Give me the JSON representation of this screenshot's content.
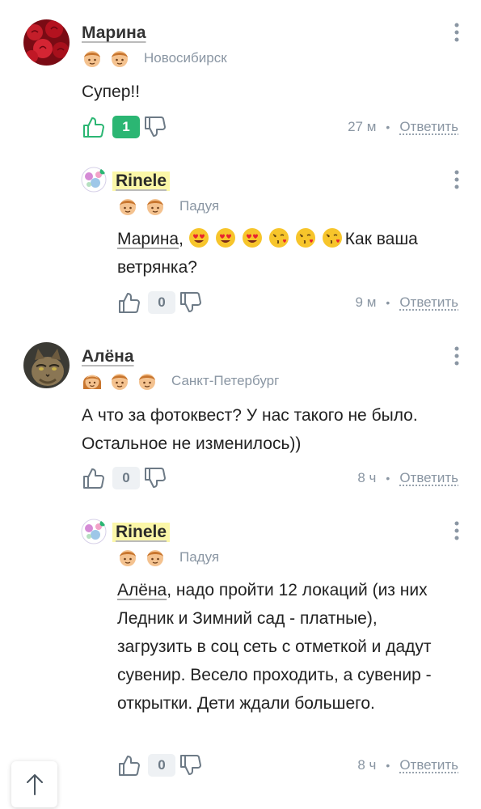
{
  "comments": [
    {
      "author": "Марина",
      "city": "Новосибирск",
      "text": "Супер!!",
      "likes": "1",
      "time": "27 м",
      "reply_label": "Ответить"
    },
    {
      "author": "Rinele",
      "city": "Падуя",
      "mention": "Марина",
      "text": "Как ваша ветрянка?",
      "likes": "0",
      "time": "9 м",
      "reply_label": "Ответить"
    },
    {
      "author": "Алёна",
      "city": "Санкт-Петербург",
      "text": "А что за фотоквест? У нас такого не было. Остальное не изменилось))",
      "likes": "0",
      "time": "8 ч",
      "reply_label": "Ответить"
    },
    {
      "author": "Rinele",
      "city": "Падуя",
      "mention": "Алёна",
      "text": ", надо пройти 12 локаций (из них Ледник и Зимний сад - платные), загрузить в соц сеть с отметкой и дадут сувенир. Весело проходить, а сувенир - открытки. Дети ждали большего.",
      "likes": "0",
      "time": "8 ч",
      "reply_label": "Ответить"
    }
  ],
  "colors": {
    "accent_green": "#2bb673",
    "highlight": "#fbf7a8",
    "meta_gray": "#8a96a3"
  },
  "icons": [
    "like-icon",
    "dislike-icon",
    "more-icon",
    "arrow-up-icon",
    "badge-face-icon",
    "heart-eyes-emoji",
    "kiss-emoji"
  ]
}
